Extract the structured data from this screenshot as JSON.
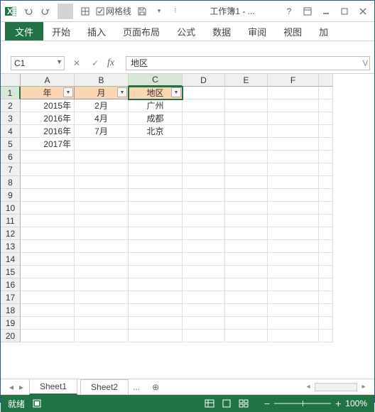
{
  "title": "工作簿1 - ...",
  "qat": {
    "gridlines_label": "网格线"
  },
  "ribbon": {
    "file": "文件",
    "tabs": [
      "开始",
      "插入",
      "页面布局",
      "公式",
      "数据",
      "审阅",
      "视图",
      "加"
    ]
  },
  "namebox": "C1",
  "formula": "地区",
  "columns": [
    "A",
    "B",
    "C",
    "D",
    "E",
    "F"
  ],
  "row_count": 20,
  "table": {
    "headers": [
      "年",
      "月",
      "地区"
    ],
    "rows": [
      {
        "y": "2015年",
        "m": "2月",
        "r": "广州"
      },
      {
        "y": "2016年",
        "m": "4月",
        "r": "成都"
      },
      {
        "y": "2016年",
        "m": "7月",
        "r": "北京"
      },
      {
        "y": "2017年",
        "m": "",
        "r": ""
      }
    ]
  },
  "sheets": {
    "active": "Sheet1",
    "others": [
      "Sheet2"
    ],
    "more": "..."
  },
  "status": {
    "ready": "就绪",
    "zoom": "100%"
  }
}
